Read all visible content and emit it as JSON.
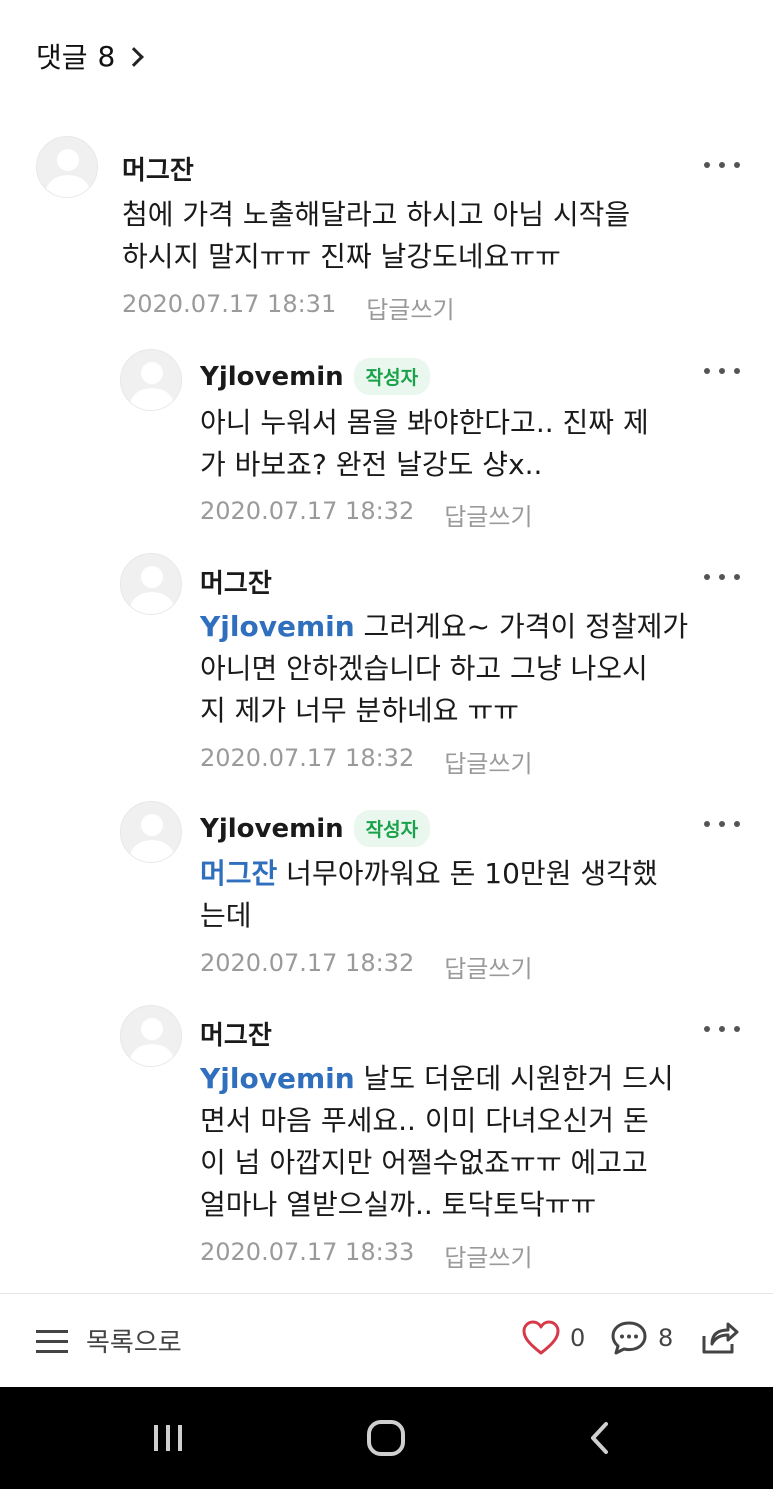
{
  "header": {
    "title": "댓글",
    "count": "8"
  },
  "comments": [
    {
      "author": "머그잔",
      "badge": "",
      "mention": "",
      "text": "첨에 가격 노출해달라고 하시고 아님 시작을\n하시지 말지ㅠㅠ 진짜 날강도네요ㅠㅠ",
      "date": "2020.07.17 18:31",
      "reply_label": "답글쓰기"
    },
    {
      "author": "Yjlovemin",
      "badge": "작성자",
      "mention": "",
      "text": "아니 누워서 몸을 봐야한다고.. 진짜 제\n가 바보죠? 완전 날강도 샹x..",
      "date": "2020.07.17 18:32",
      "reply_label": "답글쓰기"
    },
    {
      "author": "머그잔",
      "badge": "",
      "mention": "Yjlovemin",
      "text": " 그러게요~ 가격이 정찰제가\n아니면 안하겠습니다 하고 그냥 나오시\n지 제가 너무 분하네요 ㅠㅠ",
      "date": "2020.07.17 18:32",
      "reply_label": "답글쓰기"
    },
    {
      "author": "Yjlovemin",
      "badge": "작성자",
      "mention": "머그잔",
      "text": " 너무아까워요 돈 10만원 생각했\n는데",
      "date": "2020.07.17 18:32",
      "reply_label": "답글쓰기"
    },
    {
      "author": "머그잔",
      "badge": "",
      "mention": "Yjlovemin",
      "text": " 날도 더운데 시원한거 드시\n면서 마음 푸세요.. 이미 다녀오신거 돈\n이 넘 아깝지만 어쩔수없죠ㅠㅠ 에고고\n얼마나 열받으실까.. 토닥토닥ㅠㅠ",
      "date": "2020.07.17 18:33",
      "reply_label": "답글쓰기"
    }
  ],
  "bottom_bar": {
    "list_label": "목록으로",
    "like_count": "0",
    "comment_count": "8"
  },
  "icons": {
    "list": "hamburger-icon",
    "like": "heart-icon",
    "comment": "speech-bubble-icon",
    "share": "share-icon",
    "more": "more-dots-icon",
    "nav_recent": "recent-apps-icon",
    "nav_home": "home-icon",
    "nav_back": "back-icon"
  },
  "colors": {
    "mention": "#2f6fbd",
    "badge_text": "#19a24a",
    "badge_bg": "#e9f7ee",
    "like": "#d63a4a",
    "meta": "#9a9a9a"
  }
}
